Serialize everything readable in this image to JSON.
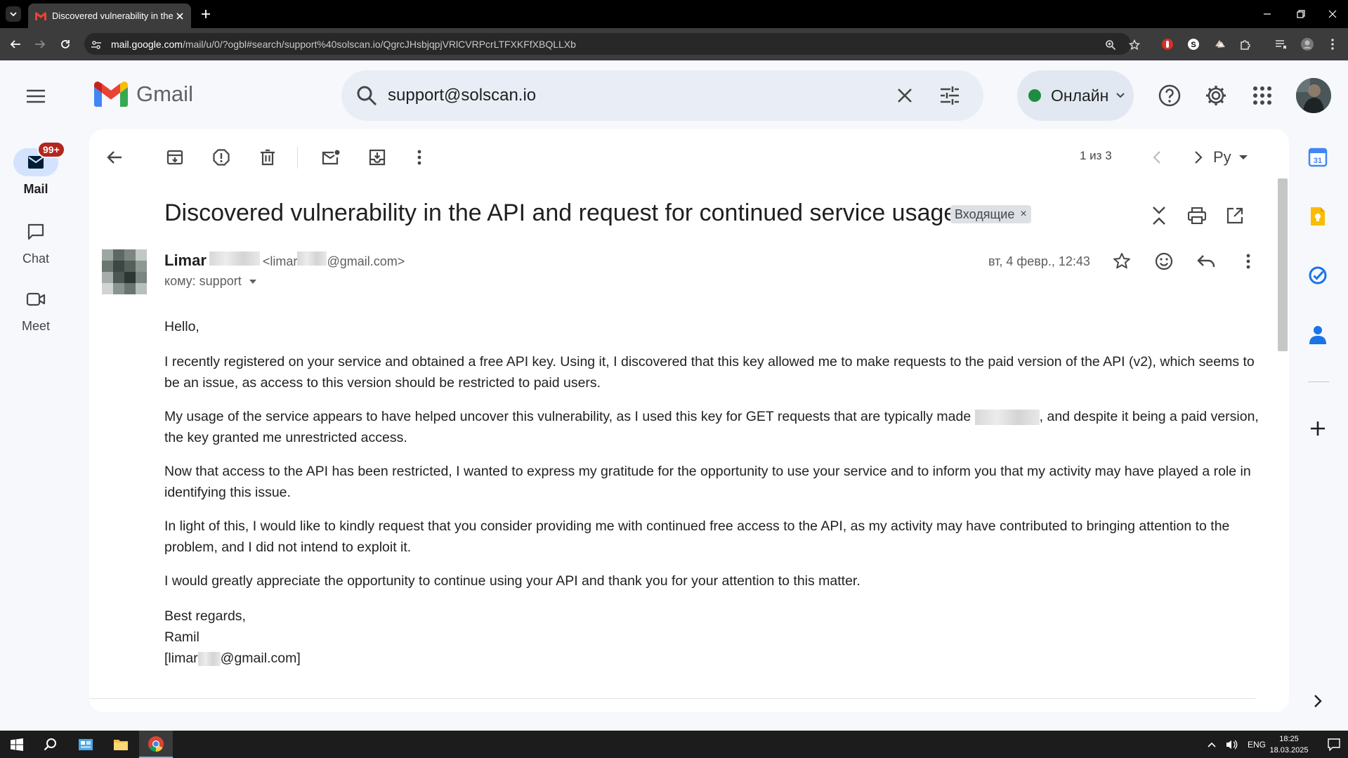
{
  "browser": {
    "tab_title": "Discovered vulnerability in the API and request for continued service usage",
    "url_host": "mail.google.com",
    "url_path": "/mail/u/0/?ogbl#search/support%40solscan.io/QgrcJHsbjqpjVRlCVRPcrLTFXKFfXBQLLXb"
  },
  "gmail": {
    "logo_text": "Gmail",
    "search_value": "support@solscan.io",
    "status_label": "Онлайн",
    "rail": {
      "mail_label": "Mail",
      "mail_badge": "99+",
      "chat_label": "Chat",
      "meet_label": "Meet"
    },
    "toolbar": {
      "pager": "1 из 3",
      "lang": "Ру"
    },
    "message": {
      "subject": "Discovered vulnerability in the API and request for continued service usage",
      "label": "Входящие",
      "sender_name": "Limar",
      "sender_email_start": "<limar",
      "sender_email_end": "@gmail.com>",
      "to": "кому: support",
      "date": "вт, 4 февр., 12:43",
      "greeting": "Hello,",
      "p1": "I recently registered on your service and obtained a free API key. Using it, I discovered that this key allowed me to make requests to the paid version of the API (v2), which seems to be an issue, as access to this version should be restricted to paid users.",
      "p2_start": "My usage of the service appears to have helped uncover this vulnerability, as I used this key for GET requests that are typically made",
      "p2_end": ", and despite it being a paid version, the key granted me unrestricted access.",
      "p3": "Now that access to the API has been restricted, I wanted to express my gratitude for the opportunity to use your service and to inform you that my activity may have played a role in identifying this issue.",
      "p4": "In light of this, I would like to kindly request that you consider providing me with continued free access to the API, as my activity may have contributed to bringing attention to the problem, and I did not intend to exploit it.",
      "p5": "I would greatly appreciate the opportunity to continue using your API and thank you for your attention to this matter.",
      "sign_off": "Best regards,",
      "sign_name": "Ramil",
      "sign_email_start": "[limar",
      "sign_email_end": "@gmail.com]"
    }
  },
  "taskbar": {
    "lang": "ENG",
    "time": "18:25",
    "date": "18.03.2025"
  },
  "colors": {
    "gmail_red": "#ea4335",
    "accent_blue": "#0b57d0",
    "online_green": "#1e8e3e",
    "badge_red": "#b3261e"
  }
}
